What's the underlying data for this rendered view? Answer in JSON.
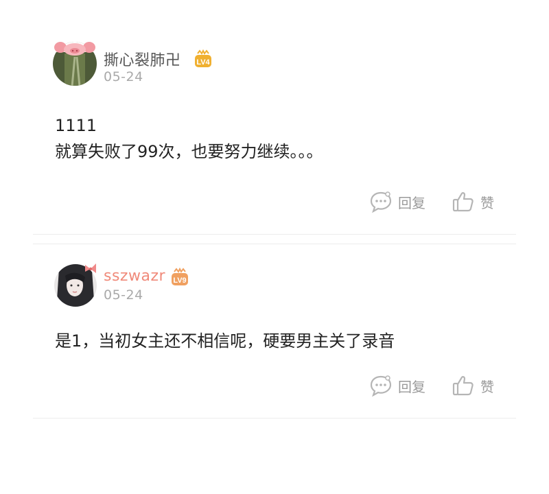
{
  "comments": [
    {
      "username": "撕心裂肺卍",
      "level": "LV4",
      "date": "05-24",
      "lines": [
        "1111",
        "就算失败了99次，也要努力继续。。。"
      ],
      "reply_label": "回复",
      "like_label": "赞",
      "name_color": "#555555",
      "badge_color": "#f0b030"
    },
    {
      "username": "sszwazr",
      "level": "LV9",
      "date": "05-24",
      "lines": [
        "是1，当初女主还不相信呢，硬要男主关了录音"
      ],
      "reply_label": "回复",
      "like_label": "赞",
      "name_color": "#f08a7a",
      "badge_color": "#f0a060"
    }
  ],
  "icons": {
    "reply": "comment-bubble-icon",
    "like": "thumbs-up-icon"
  }
}
